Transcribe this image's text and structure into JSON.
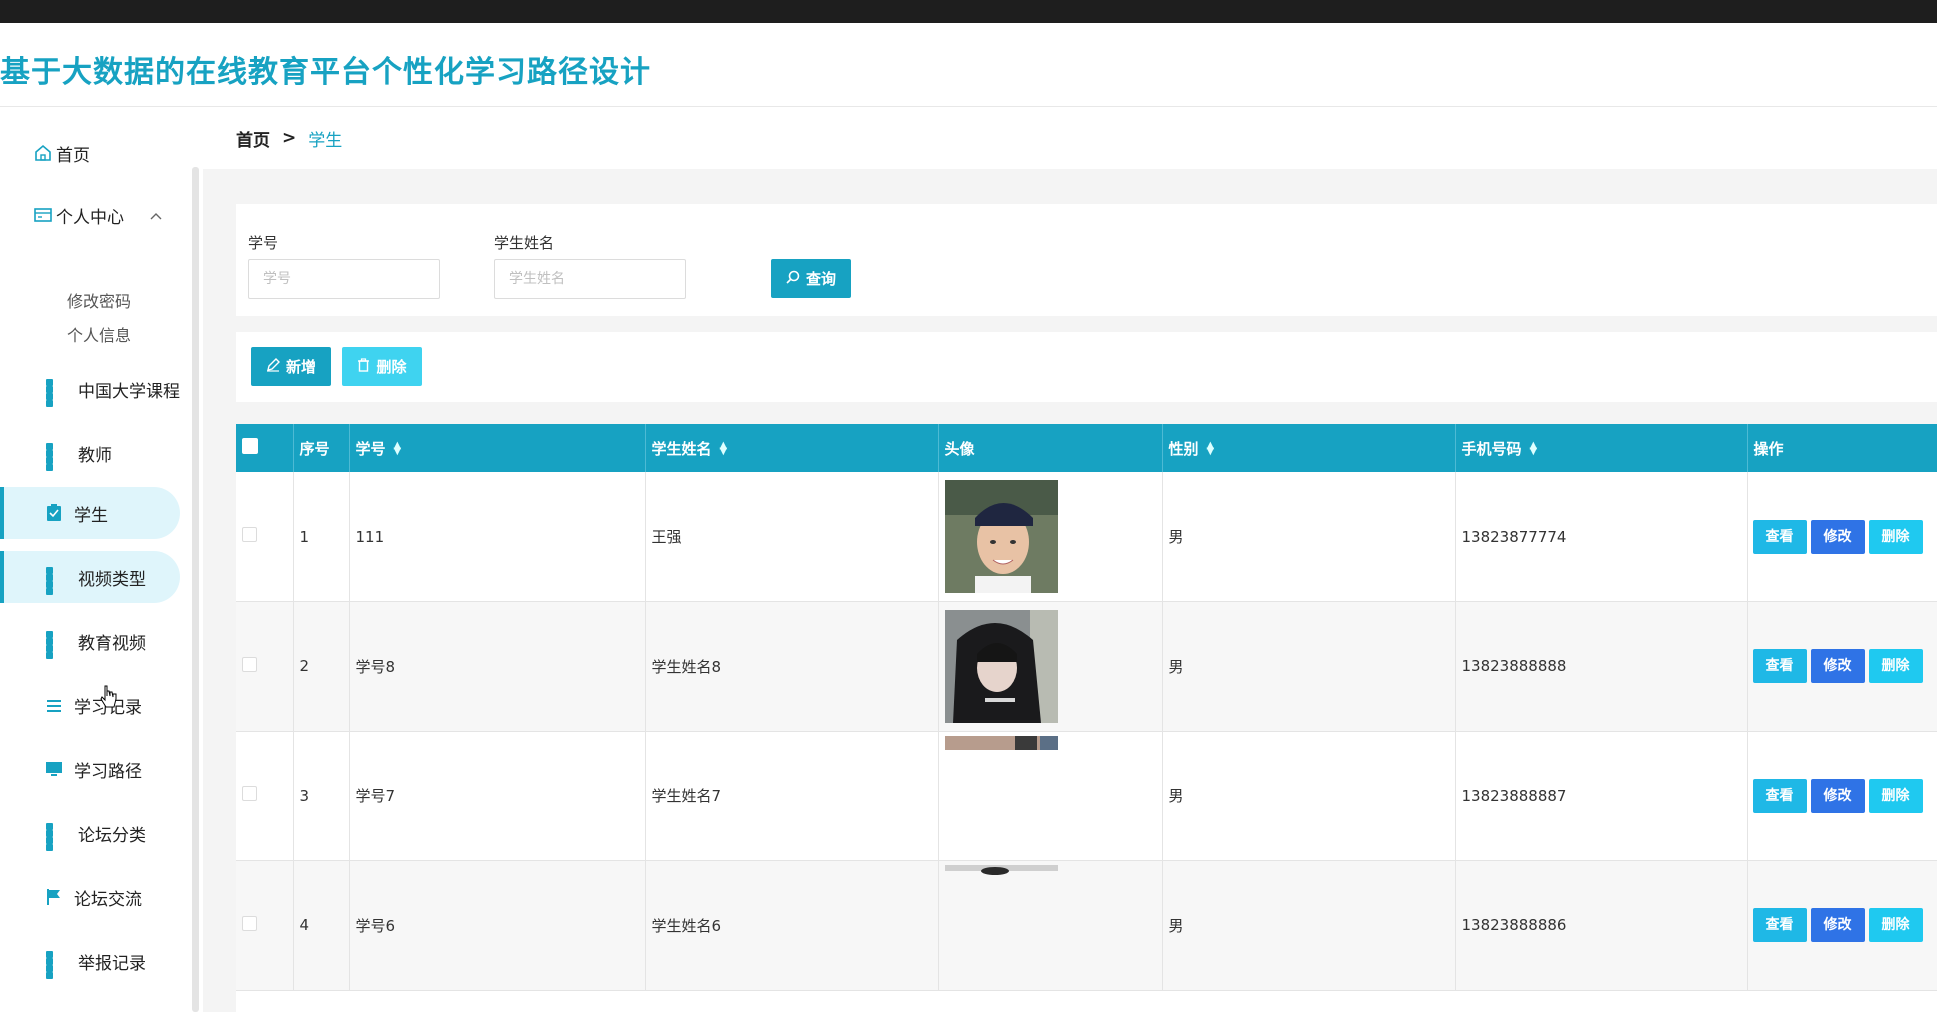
{
  "header": {
    "title": "基于大数据的在线教育平台个性化学习路径设计"
  },
  "sidebar": {
    "items": [
      {
        "label": "首页",
        "icon": "home-icon"
      },
      {
        "label": "个人中心",
        "icon": "card-icon",
        "expanded": true,
        "children": [
          {
            "label": "修改密码"
          },
          {
            "label": "个人信息"
          }
        ]
      },
      {
        "label": "中国大学课程",
        "icon": "grid-icon"
      },
      {
        "label": "教师",
        "icon": "grid-icon"
      },
      {
        "label": "学生",
        "icon": "clipboard-icon",
        "active": true
      },
      {
        "label": "视频类型",
        "icon": "grid-icon",
        "hovered": true
      },
      {
        "label": "教育视频",
        "icon": "grid-icon"
      },
      {
        "label": "学习记录",
        "icon": "list-icon"
      },
      {
        "label": "学习路径",
        "icon": "monitor-icon"
      },
      {
        "label": "论坛分类",
        "icon": "grid-icon"
      },
      {
        "label": "论坛交流",
        "icon": "flag-icon"
      },
      {
        "label": "举报记录",
        "icon": "grid-icon"
      }
    ]
  },
  "breadcrumb": {
    "home": "首页",
    "separator": ">",
    "current": "学生"
  },
  "search": {
    "fields": [
      {
        "label": "学号",
        "placeholder": "学号"
      },
      {
        "label": "学生姓名",
        "placeholder": "学生姓名"
      }
    ],
    "button_label": "查询"
  },
  "actions": {
    "add_label": "新增",
    "delete_label": "删除"
  },
  "table": {
    "columns": [
      "序号",
      "学号",
      "学生姓名",
      "头像",
      "性别",
      "手机号码",
      "操作"
    ],
    "rows": [
      {
        "index": "1",
        "student_id": "111",
        "name": "王强",
        "gender": "男",
        "phone": "13823877774"
      },
      {
        "index": "2",
        "student_id": "学号8",
        "name": "学生姓名8",
        "gender": "男",
        "phone": "13823888888"
      },
      {
        "index": "3",
        "student_id": "学号7",
        "name": "学生姓名7",
        "gender": "男",
        "phone": "13823888887"
      },
      {
        "index": "4",
        "student_id": "学号6",
        "name": "学生姓名6",
        "gender": "男",
        "phone": "13823888886"
      }
    ],
    "row_actions": {
      "view": "查看",
      "edit": "修改",
      "remove": "删除"
    }
  },
  "colors": {
    "accent": "#17a2c2",
    "edit_button": "#2f73e6",
    "view_button": "#1fb8e6",
    "topbar": "#1e1e1e"
  }
}
